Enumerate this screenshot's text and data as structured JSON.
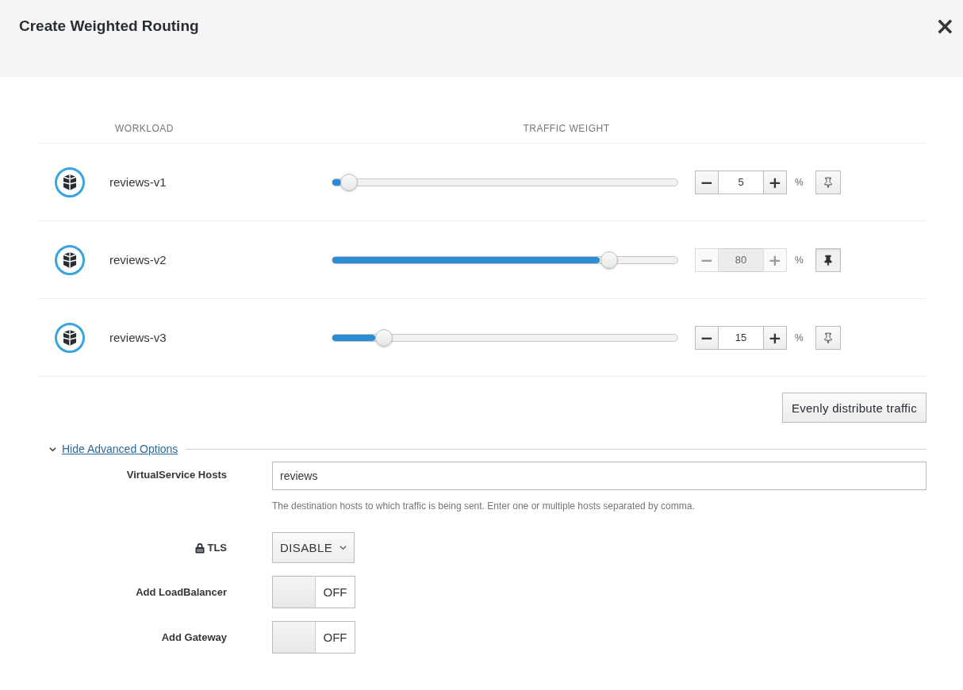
{
  "dialog": {
    "title": "Create Weighted Routing",
    "close": "×"
  },
  "table": {
    "columns": [
      "WORKLOAD",
      "TRAFFIC WEIGHT"
    ],
    "rows": [
      {
        "name": "reviews-v1",
        "level": 0.05,
        "value": "5",
        "pinned": false,
        "unit": "%",
        "minus": "−",
        "plus": "+"
      },
      {
        "name": "reviews-v2",
        "level": 0.8,
        "value": "80",
        "pinned": true,
        "unit": "%",
        "minus": "−",
        "plus": "+"
      },
      {
        "name": "reviews-v3",
        "level": 0.15,
        "value": "15",
        "pinned": false,
        "unit": "%",
        "minus": "−",
        "plus": "+"
      }
    ]
  },
  "even_button": "Evenly distribute traffic",
  "advanced": {
    "label": "Hide Advanced Options",
    "expanded": true,
    "hosts": {
      "label": "VirtualService Hosts",
      "value": "reviews",
      "help": "The destination hosts to which traffic is being sent. Enter one or multiple hosts separated by comma."
    },
    "tls": {
      "label": "TLS",
      "value": "DISABLE"
    },
    "toggles": [
      {
        "label": "Add LoadBalancer",
        "on": false,
        "text": "OFF"
      },
      {
        "label": "Add Gateway",
        "on": false,
        "text": "OFF"
      }
    ]
  }
}
